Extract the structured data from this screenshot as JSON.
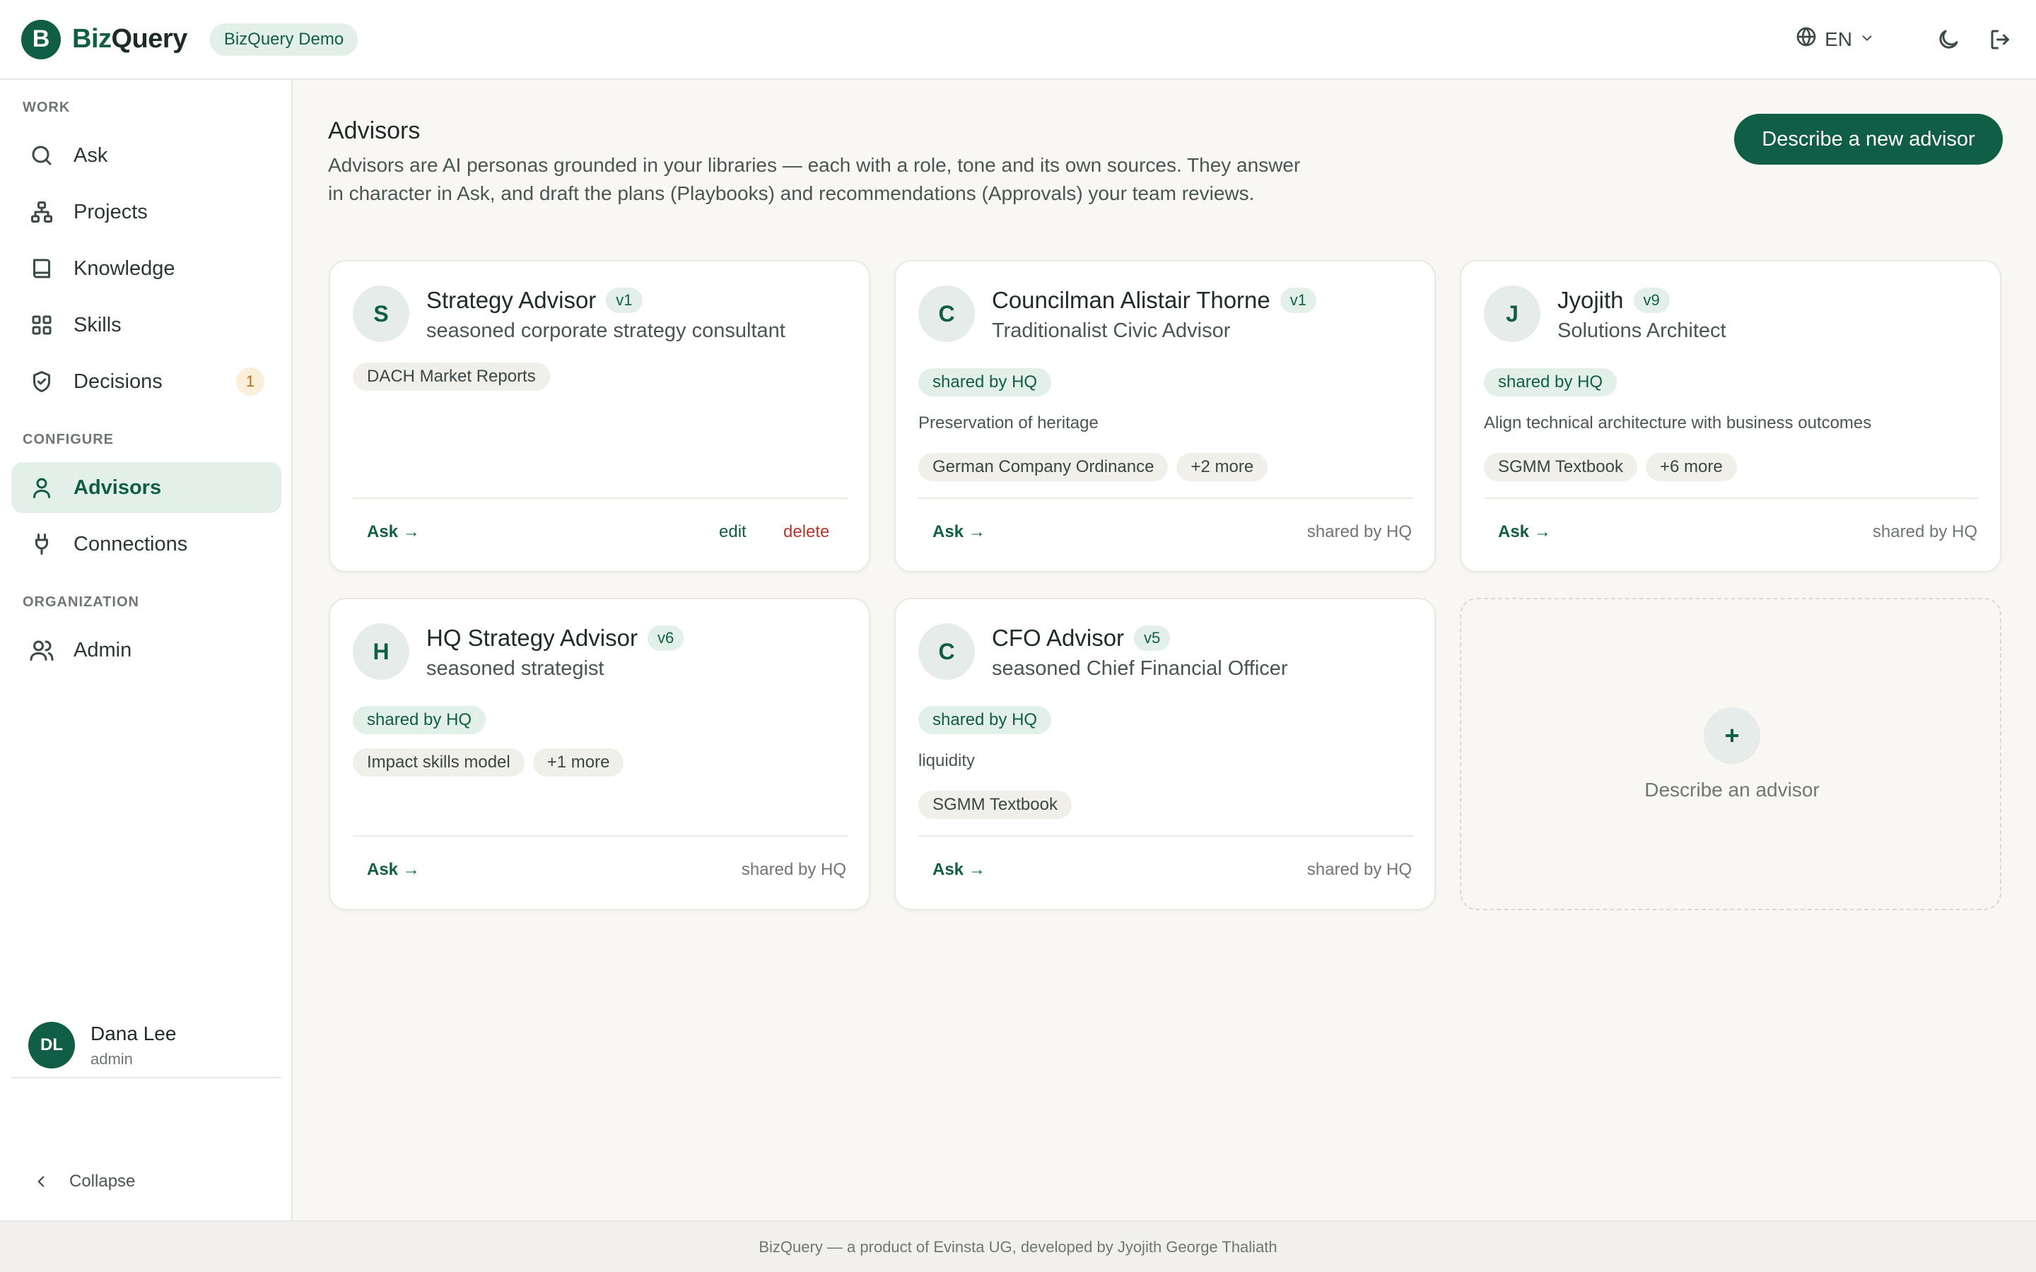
{
  "app": {
    "logo_letter": "B",
    "brand_prefix": "Biz",
    "brand_suffix": "Query",
    "demo_badge": "BizQuery Demo",
    "language": "EN",
    "accent_color": "#115e46"
  },
  "topbar": {
    "icons": [
      "globe-icon",
      "chevron-down-icon",
      "moon-icon",
      "logout-icon"
    ]
  },
  "sidebar": {
    "sections": {
      "work": "WORK",
      "configure": "CONFIGURE",
      "organization": "ORGANIZATION"
    },
    "items": [
      {
        "label": "Ask",
        "icon": "search-icon"
      },
      {
        "label": "Projects",
        "icon": "hierarchy-icon"
      },
      {
        "label": "Knowledge",
        "icon": "book-icon"
      },
      {
        "label": "Skills",
        "icon": "grid-icon"
      },
      {
        "label": "Decisions",
        "icon": "shield-check-icon",
        "badge": "1"
      },
      {
        "label": "Advisors",
        "icon": "user-icon",
        "active": true
      },
      {
        "label": "Connections",
        "icon": "plug-icon"
      },
      {
        "label": "Admin",
        "icon": "users-icon"
      }
    ],
    "user": {
      "initials": "DL",
      "name": "Dana Lee",
      "role": "admin"
    },
    "collapse_label": "Collapse"
  },
  "main": {
    "title": "Advisors",
    "description": "Advisors are AI personas grounded in your libraries — each with a role, tone and its own sources. They answer in character in Ask, and draft the plans (Playbooks) and recommendations (Approvals) your team reviews.",
    "new_button": "Describe a new advisor"
  },
  "advisors": [
    {
      "initial": "S",
      "name": "Strategy Advisor",
      "version": "v1",
      "role": "seasoned corporate strategy consultant",
      "sources": [
        "DACH Market Reports"
      ],
      "ask": "Ask →",
      "edit": "edit",
      "delete": "delete"
    },
    {
      "initial": "C",
      "name": "Councilman Alistair Thorne",
      "version": "v1",
      "role": "Traditionalist Civic Advisor",
      "shared": "shared by HQ",
      "focus": "Preservation of heritage",
      "sources": [
        "German Company Ordinance",
        "+2 more"
      ],
      "ask": "Ask →",
      "owner": "shared by HQ"
    },
    {
      "initial": "J",
      "name": "Jyojith",
      "version": "v9",
      "role": "Solutions Architect",
      "shared": "shared by HQ",
      "focus": "Align technical architecture with business outcomes",
      "sources": [
        "SGMM Textbook",
        "+6 more"
      ],
      "ask": "Ask →",
      "owner": "shared by HQ"
    },
    {
      "initial": "H",
      "name": "HQ Strategy Advisor",
      "version": "v6",
      "role": "seasoned strategist",
      "shared": "shared by HQ",
      "sources": [
        "Impact skills model",
        "+1 more"
      ],
      "ask": "Ask →",
      "owner": "shared by HQ"
    },
    {
      "initial": "C",
      "name": "CFO Advisor",
      "version": "v5",
      "role": "seasoned Chief Financial Officer",
      "shared": "shared by HQ",
      "focus": "liquidity",
      "sources": [
        "SGMM Textbook"
      ],
      "ask": "Ask →",
      "owner": "shared by HQ"
    }
  ],
  "add_card": {
    "plus": "+",
    "label": "Describe an advisor"
  },
  "footer": {
    "text": "BizQuery — a product of Evinsta UG, developed by Jyojith George Thaliath"
  }
}
